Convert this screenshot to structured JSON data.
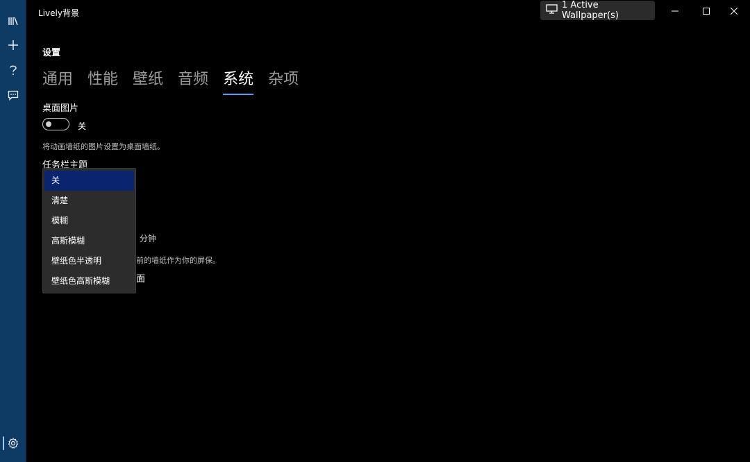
{
  "window": {
    "title": "Lively背景",
    "active_wallpaper": "1 Active Wallpaper(s)"
  },
  "rail": {
    "items": [
      "library-icon",
      "add-icon",
      "help-icon",
      "feedback-icon"
    ],
    "bottom_item": "gear-icon"
  },
  "settings": {
    "heading": "设置",
    "tabs": [
      "通用",
      "性能",
      "壁纸",
      "音频",
      "系统",
      "杂项"
    ],
    "active_tab": "系统"
  },
  "desktop_picture": {
    "label": "桌面图片",
    "toggle_state": "关",
    "description": "将动画墙纸的图片设置为桌面墙纸。"
  },
  "taskbar_theme": {
    "label": "任务栏主题",
    "options": [
      "关",
      "清楚",
      "模糊",
      "高斯模糊",
      "壁纸色半透明",
      "壁纸色高斯模糊"
    ],
    "selected": "关"
  },
  "behind_menu": {
    "minutes_suffix": "分钟",
    "screensaver_desc_fragment": "前的墙纸作为你的屏保。",
    "label_fragment": "面"
  },
  "colors": {
    "rail": "#0e3b63",
    "accent": "#4aa3ff",
    "dropdown_selected": "#0a2470"
  }
}
